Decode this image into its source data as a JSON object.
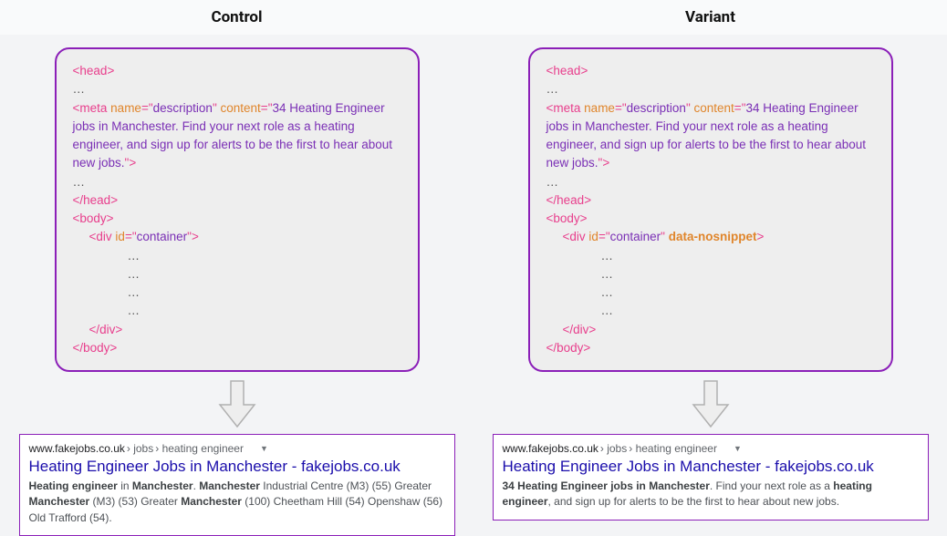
{
  "header": {
    "control": "Control",
    "variant": "Variant"
  },
  "code": {
    "head_open": "head",
    "head_text": "head",
    "ellipsis": "…",
    "meta": "meta",
    "name_attr": "name",
    "name_val": "description",
    "content_attr": "content",
    "meta_text": "34 Heating Engineer jobs in Manchester. Find your next role as a heating engineer, and sign up for alerts to be the first to hear about new jobs.",
    "head_close": "head",
    "body_open": "body",
    "div": "div",
    "id_attr": "id",
    "id_val": "container",
    "nosnippet": "data-nosnippet",
    "div_close": "div",
    "body_close": "body"
  },
  "serp": {
    "domain": "www.fakejobs.co.uk",
    "crumb1": " › jobs",
    "crumb2": " › heating engineer",
    "title": "Heating Engineer Jobs in Manchester - fakejobs.co.uk",
    "control_b1": "Heating engineer",
    "control_t1": " in ",
    "control_b2": "Manchester",
    "control_t2": ". ",
    "control_b3": "Manchester",
    "control_t3": " Industrial Centre (M3) (55) Greater ",
    "control_b4": "Manchester",
    "control_t4": " (M3) (53) Greater ",
    "control_b5": "Manchester",
    "control_t5": " (100) Cheetham Hill (54) Openshaw (56) Old Trafford (54).",
    "variant_b1": "34 Heating Engineer jobs in Manchester",
    "variant_t1": ". Find your next role as a ",
    "variant_b2": "heating engineer",
    "variant_t2": ", and sign up for alerts to be the first to hear about new jobs."
  }
}
